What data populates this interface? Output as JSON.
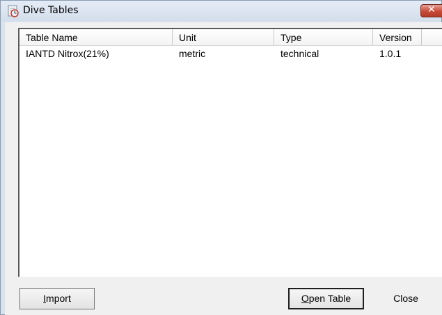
{
  "window": {
    "title": "Dive Tables",
    "app_icon": "dive-table-icon",
    "close_glyph": "✕"
  },
  "list": {
    "columns": [
      "Table Name",
      "Unit",
      "Type",
      "Version"
    ],
    "rows": [
      [
        "IANTD Nitrox(21%)",
        "metric",
        "technical",
        "1.0.1"
      ]
    ]
  },
  "buttons": {
    "import": {
      "mnemonic": "I",
      "rest": "mport"
    },
    "open": {
      "mnemonic": "O",
      "rest": "pen Table"
    },
    "close_label": "Close"
  }
}
